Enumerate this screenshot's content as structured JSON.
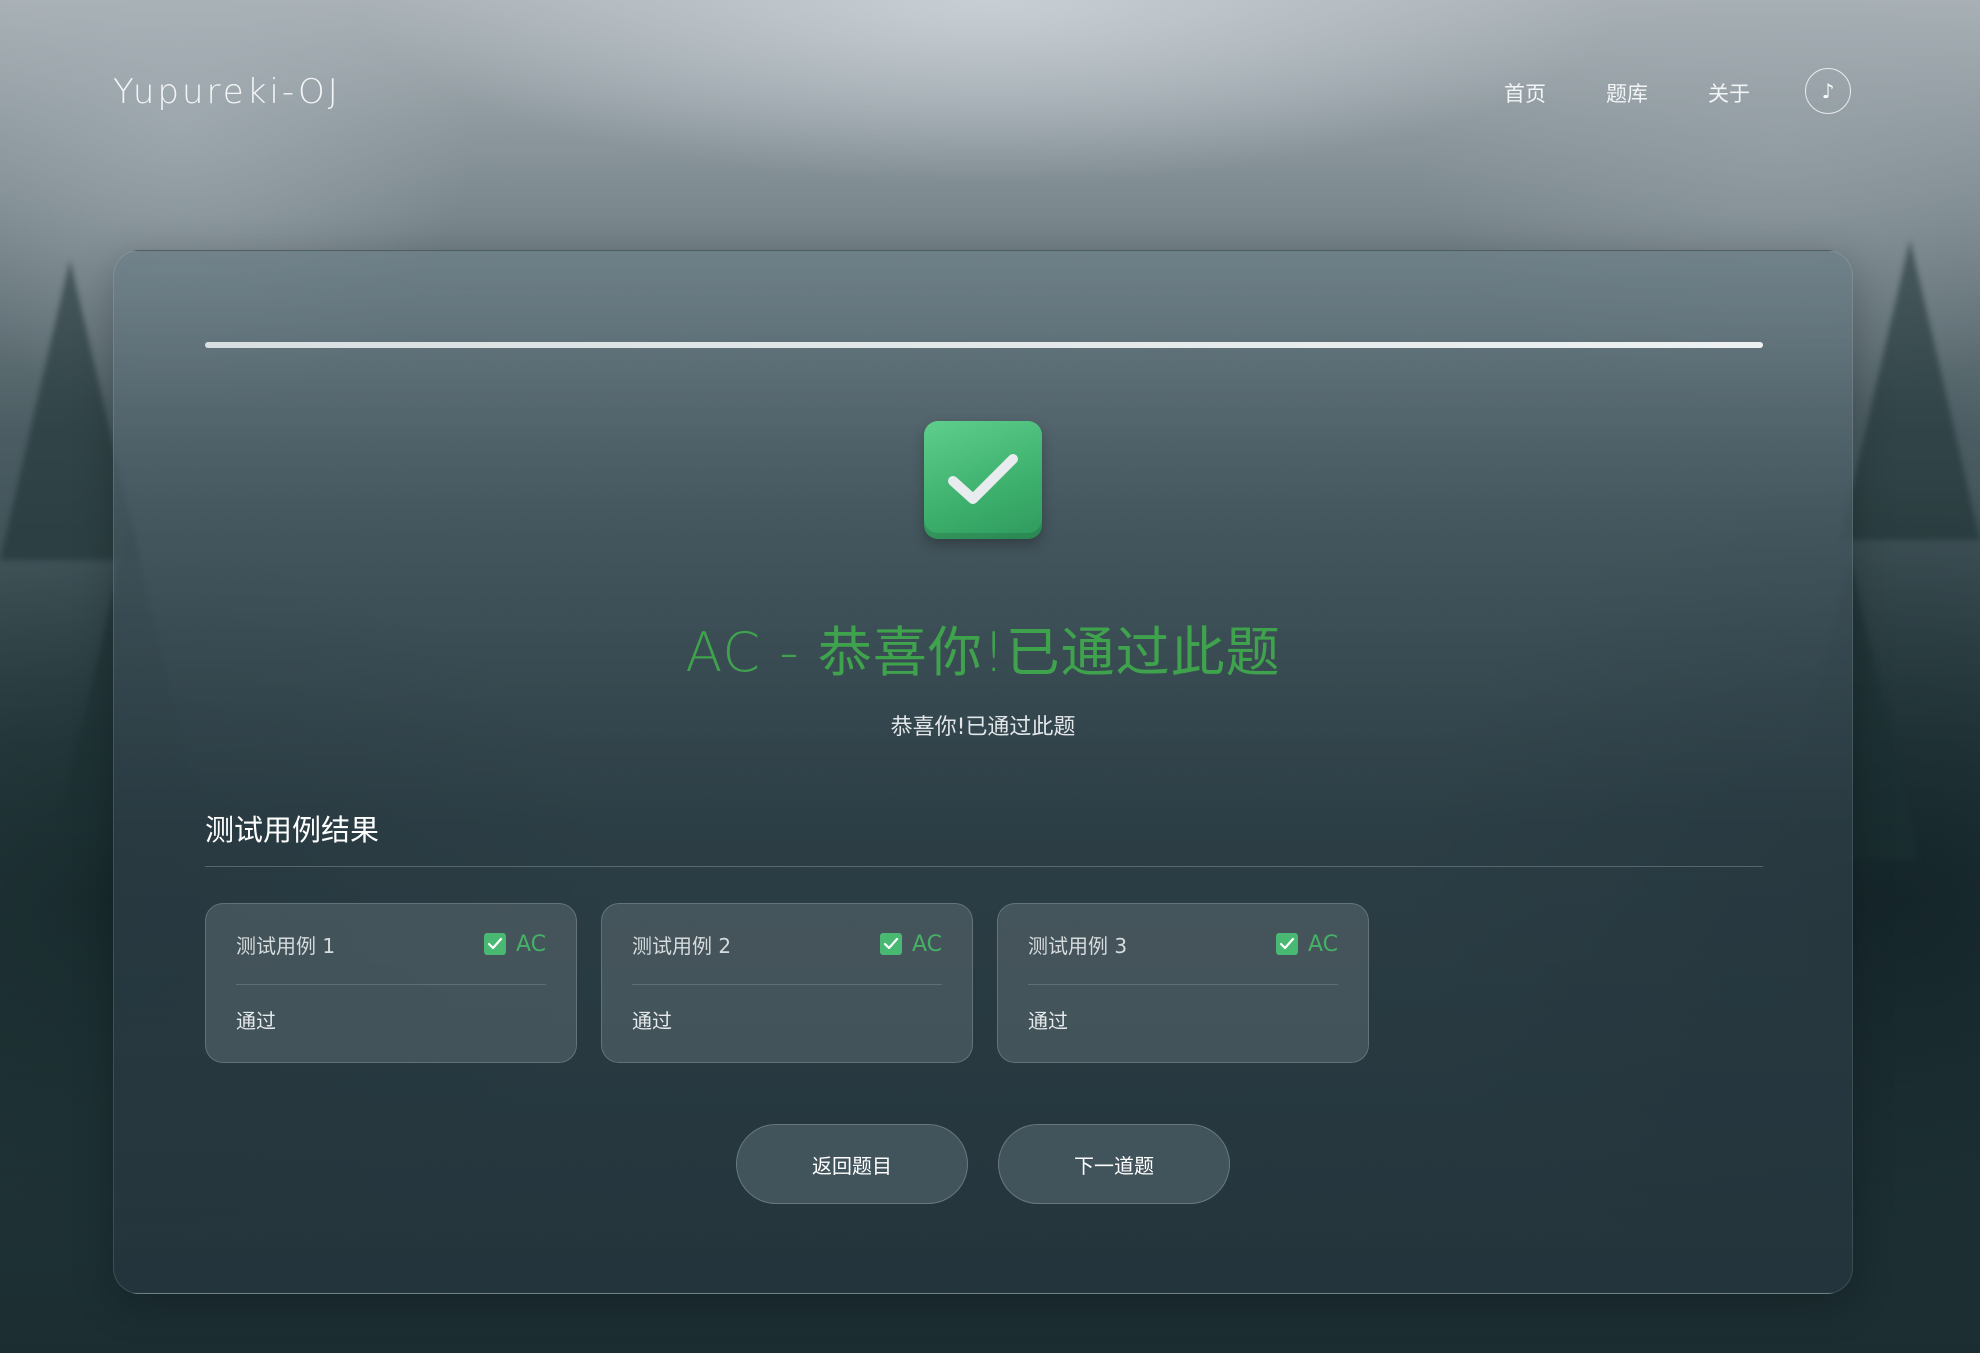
{
  "navbar": {
    "brand": "Yupureki-OJ",
    "links": [
      {
        "label": "首页"
      },
      {
        "label": "题库"
      },
      {
        "label": "关于"
      }
    ],
    "music_icon": "music-note-icon",
    "music_glyph": "♪"
  },
  "result": {
    "progress_percent": 100,
    "status_icon": "check-box-icon",
    "title": "AC - 恭喜你!已通过此题",
    "subtitle": "恭喜你!已通过此题",
    "accent_color": "#3fa34d"
  },
  "test_cases": {
    "section_title": "测试用例结果",
    "items": [
      {
        "name": "测试用例 1",
        "status": "AC",
        "detail": "通过"
      },
      {
        "name": "测试用例 2",
        "status": "AC",
        "detail": "通过"
      },
      {
        "name": "测试用例 3",
        "status": "AC",
        "detail": "通过"
      }
    ]
  },
  "actions": {
    "back_label": "返回题目",
    "next_label": "下一道题"
  }
}
